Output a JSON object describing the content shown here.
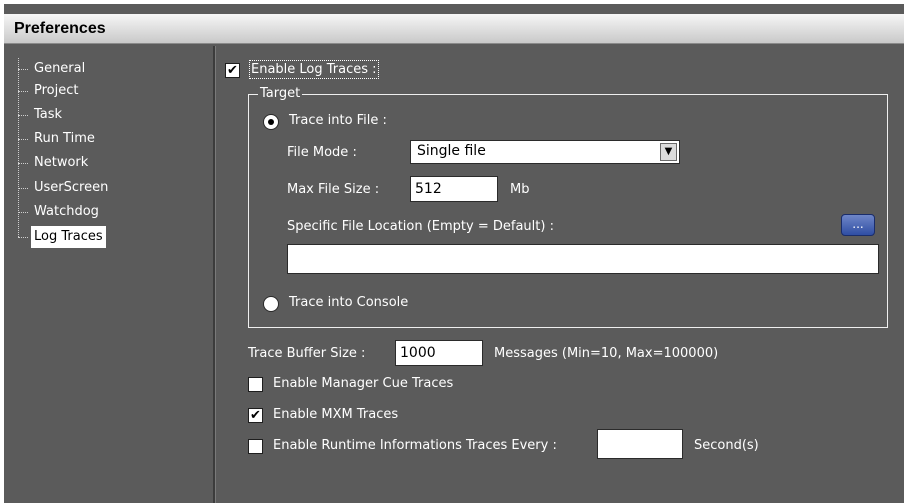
{
  "window": {
    "title": "Preferences"
  },
  "tree": {
    "items": [
      {
        "label": "General"
      },
      {
        "label": "Project"
      },
      {
        "label": "Task"
      },
      {
        "label": "Run Time"
      },
      {
        "label": "Network"
      },
      {
        "label": "UserScreen"
      },
      {
        "label": "Watchdog"
      },
      {
        "label": "Log Traces",
        "selected": true
      }
    ]
  },
  "log_traces": {
    "enable_label": "Enable Log Traces :",
    "enable_checked": true,
    "target": {
      "group_label": "Target",
      "trace_file_label": "Trace into File :",
      "trace_file_selected": true,
      "file_mode_label": "File Mode :",
      "file_mode_value": "Single file",
      "max_file_size_label": "Max File Size :",
      "max_file_size_value": "512",
      "max_file_size_unit": "Mb",
      "location_label": "Specific File Location (Empty = Default) :",
      "location_value": "",
      "browse_label": "...",
      "trace_console_label": "Trace into Console",
      "trace_console_selected": false
    },
    "buffer_size_label": "Trace Buffer Size :",
    "buffer_size_value": "1000",
    "buffer_size_hint": "Messages (Min=10, Max=100000)",
    "manager_cue_label": "Enable Manager Cue Traces",
    "manager_cue_checked": false,
    "mxm_label": "Enable MXM Traces",
    "mxm_checked": true,
    "runtime_info_label": "Enable Runtime Informations Traces Every :",
    "runtime_info_checked": false,
    "runtime_info_value": "",
    "runtime_info_unit": "Second(s)"
  },
  "icons": {
    "check": "✔",
    "dropdown": "▼"
  }
}
